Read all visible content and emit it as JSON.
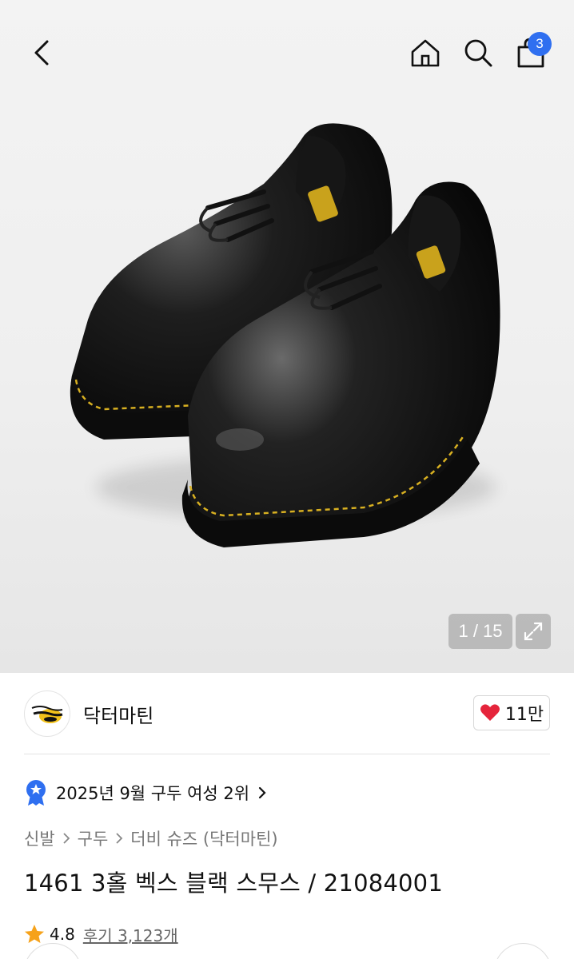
{
  "header": {
    "cart_count": "3"
  },
  "gallery": {
    "counter": "1 / 15"
  },
  "brand": {
    "name": "닥터마틴",
    "likes": "11만"
  },
  "ranking": {
    "text": "2025년 9월 구두 여성 2위"
  },
  "breadcrumb": [
    "신발",
    "구두",
    "더비 슈즈 (닥터마틴)"
  ],
  "product": {
    "title": "1461 3홀 벡스 블랙 스무스 / 21084001",
    "rating": "4.8",
    "reviews": "후기 3,123개"
  },
  "colors": {
    "accent_blue": "#2f6ff0",
    "heart_red": "#e5243b",
    "star_orange": "#f6a21a",
    "rank_badge_blue": "#2f6ff0"
  },
  "icons": [
    "back-arrow-icon",
    "home-icon",
    "search-icon",
    "shopping-bag-icon",
    "expand-icon",
    "heart-icon",
    "rank-medal-icon",
    "chevron-right-icon",
    "star-icon"
  ]
}
